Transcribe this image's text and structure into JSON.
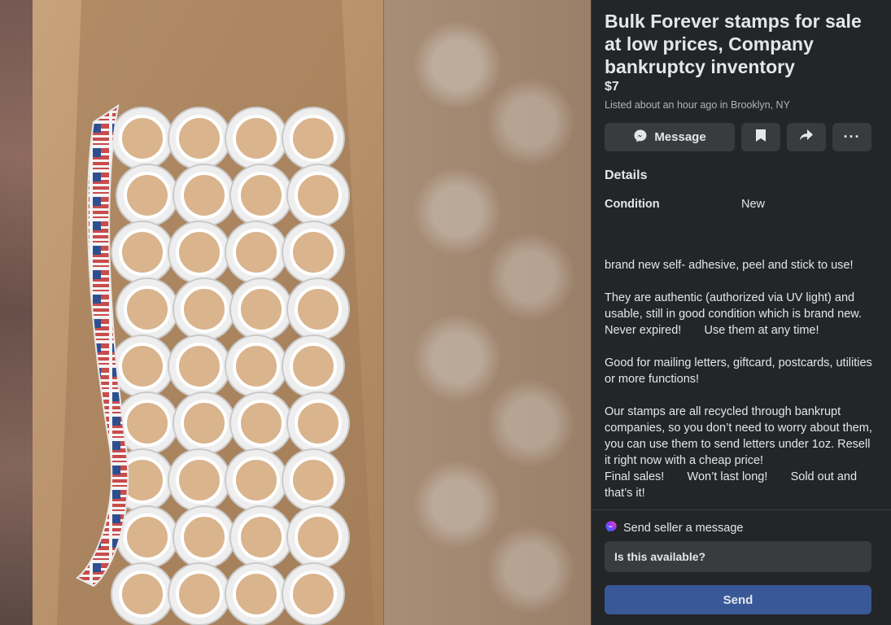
{
  "listing": {
    "title": "Bulk Forever stamps for sale at low prices, Company bankruptcy inventory",
    "price": "$7",
    "listed": "Listed about an hour ago in Brooklyn, NY"
  },
  "actions": {
    "message_label": "Message",
    "message_icon": "messenger-icon",
    "save_icon": "bookmark-icon",
    "share_icon": "share-icon",
    "more_label": "···"
  },
  "details": {
    "heading": "Details",
    "condition_label": "Condition",
    "condition_value": "New"
  },
  "description": [
    "brand new self- adhesive, peel and stick to use!",
    "They are authentic (authorized via UV light) and usable, still in good condition which is brand new.       Never expired!       Use them at any time!",
    "Good for mailing letters, giftcard, postcards, utilities or more functions!",
    "Our stamps are all recycled through bankrupt companies, so you don’t need to worry about them, you can use them to send letters under 1oz. Resell it right now with a cheap price!\nFinal sales!       Won’t last long!       Sold out and that’s it!"
  ],
  "contact": {
    "send_seller_label": "Send seller a message",
    "message_value": "Is this available?",
    "send_label": "Send"
  },
  "colors": {
    "panel_bg": "#242526",
    "button_bg": "#3a3b3c",
    "send_button": "#385898",
    "text_primary": "#e4e6eb",
    "text_secondary": "#b0b3b8"
  }
}
